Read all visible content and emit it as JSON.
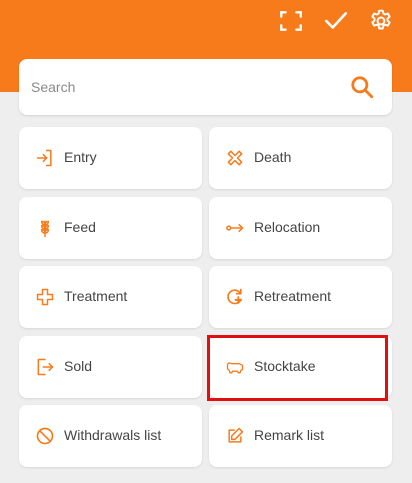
{
  "colors": {
    "accent": "#f77b1b",
    "background": "#eeeeee",
    "card": "#ffffff",
    "highlight": "#e01010"
  },
  "header": {
    "icons": [
      "scan-frame-icon",
      "check-icon",
      "gear-icon"
    ]
  },
  "search": {
    "placeholder": "Search",
    "value": ""
  },
  "menu": {
    "entry": "Entry",
    "death": "Death",
    "feed": "Feed",
    "relocation": "Relocation",
    "treatment": "Treatment",
    "retreatment": "Retreatment",
    "sold": "Sold",
    "stocktake": "Stocktake",
    "withdrawals_list": "Withdrawals list",
    "remark_list": "Remark list"
  }
}
